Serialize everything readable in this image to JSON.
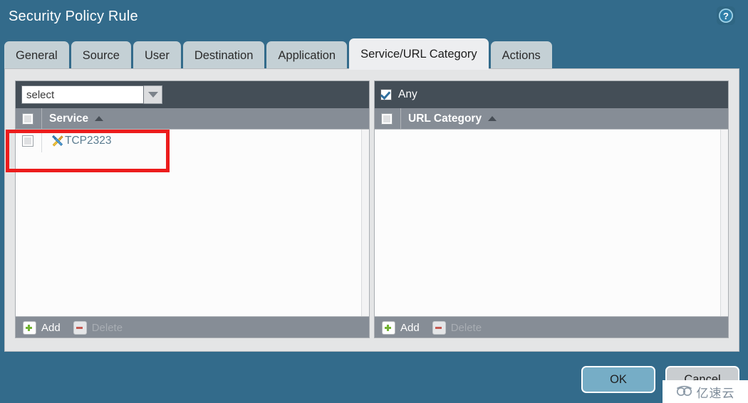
{
  "dialog": {
    "title": "Security Policy Rule",
    "help_icon": "help-circle-icon"
  },
  "tabs": [
    {
      "label": "General",
      "active": false
    },
    {
      "label": "Source",
      "active": false
    },
    {
      "label": "User",
      "active": false
    },
    {
      "label": "Destination",
      "active": false
    },
    {
      "label": "Application",
      "active": false
    },
    {
      "label": "Service/URL Category",
      "active": true
    },
    {
      "label": "Actions",
      "active": false
    }
  ],
  "service_panel": {
    "select": {
      "value": "select",
      "placeholder": "select",
      "arrow_icon": "chevron-down-icon"
    },
    "column_header": "Service",
    "sort_icon": "sort-ascending-icon",
    "header_checked": false,
    "rows": [
      {
        "label": "TCP2323",
        "icon": "tools-icon",
        "checked": false
      }
    ],
    "footer": {
      "add_label": "Add",
      "add_icon": "plus-square-icon",
      "delete_label": "Delete",
      "delete_icon": "minus-square-icon",
      "delete_disabled": true
    }
  },
  "url_panel": {
    "any": {
      "label": "Any",
      "checked": true
    },
    "column_header": "URL Category",
    "sort_icon": "sort-ascending-icon",
    "header_checked": false,
    "rows": [],
    "footer": {
      "add_label": "Add",
      "add_icon": "plus-square-icon",
      "delete_label": "Delete",
      "delete_icon": "minus-square-icon",
      "delete_disabled": true
    }
  },
  "buttons": {
    "ok": "OK",
    "cancel": "Cancel"
  },
  "watermark": {
    "text": "亿速云",
    "icon": "cloud-logo-icon"
  },
  "colors": {
    "dialog_background": "#336b8b",
    "tab_inactive": "#c4d0d5",
    "tab_active": "#edeef0",
    "panel_background": "#e4e5e6",
    "topbar_dark": "#444e57",
    "header_grey": "#868d96",
    "link_text": "#5b7c90",
    "highlight_red": "#ec1c1c",
    "ok_button": "#76adc6",
    "cancel_button": "#c9cdd0",
    "add_green": "#73b333",
    "delete_red": "#c45a52"
  }
}
